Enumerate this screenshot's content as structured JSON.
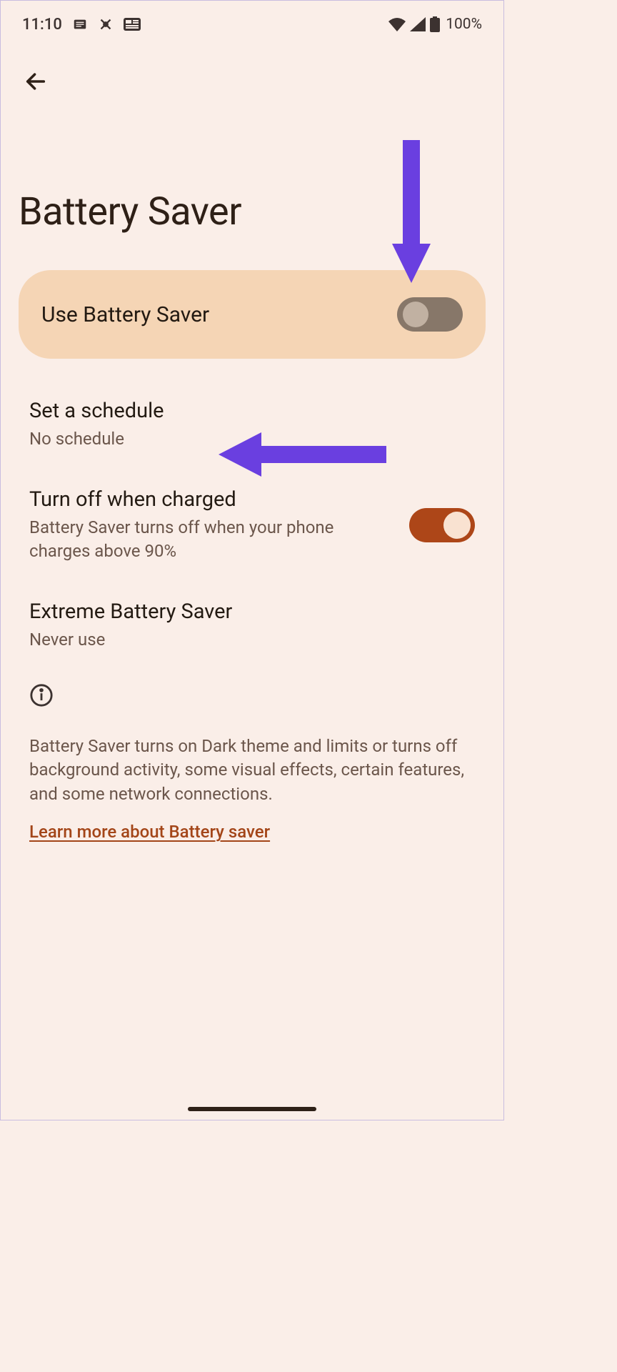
{
  "statusbar": {
    "time": "11:10",
    "battery_percent": "100%"
  },
  "page": {
    "title": "Battery Saver"
  },
  "main_toggle": {
    "label": "Use Battery Saver",
    "on": false
  },
  "settings": {
    "schedule": {
      "title": "Set a schedule",
      "subtitle": "No schedule"
    },
    "turn_off_charged": {
      "title": "Turn off when charged",
      "subtitle": "Battery Saver turns off when your phone charges above 90%",
      "on": true
    },
    "extreme": {
      "title": "Extreme Battery Saver",
      "subtitle": "Never use"
    }
  },
  "info": {
    "text": "Battery Saver turns on Dark theme and limits or turns off background activity, some visual effects, certain features, and some network connections.",
    "link": "Learn more about Battery saver"
  },
  "annotations": {
    "arrow_color": "#6a3fe0"
  }
}
